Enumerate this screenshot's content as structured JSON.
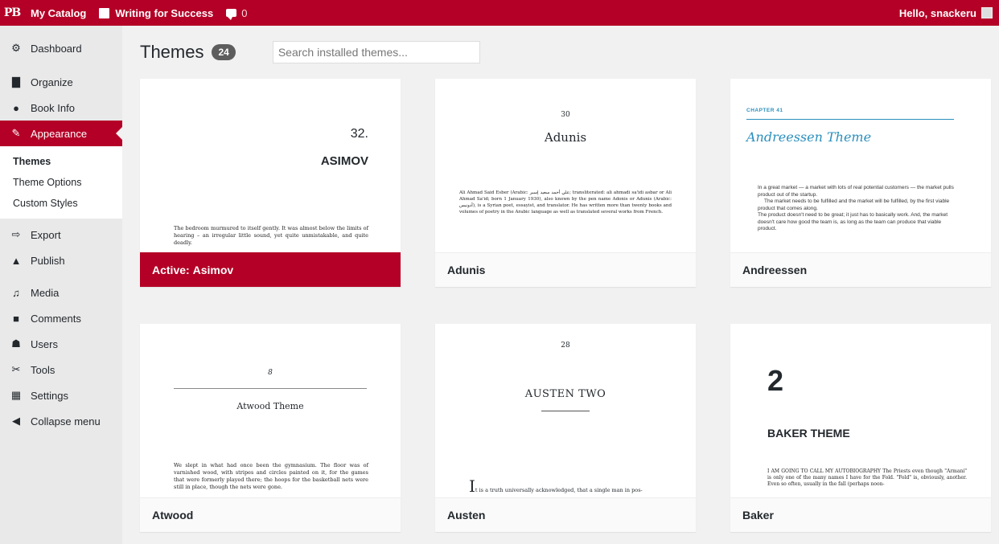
{
  "adminbar": {
    "logo": "PB",
    "catalog": "My Catalog",
    "book": "Writing for Success",
    "comments_count": "0",
    "greeting": "Hello, snackeru"
  },
  "sidebar": {
    "dashboard": "Dashboard",
    "organize": "Organize",
    "book_info": "Book Info",
    "appearance": "Appearance",
    "sub": {
      "themes": "Themes",
      "theme_options": "Theme Options",
      "custom_styles": "Custom Styles"
    },
    "export": "Export",
    "publish": "Publish",
    "media": "Media",
    "comments": "Comments",
    "users": "Users",
    "tools": "Tools",
    "settings": "Settings",
    "collapse": "Collapse menu"
  },
  "header": {
    "title": "Themes",
    "count": "24",
    "search_placeholder": "Search installed themes..."
  },
  "themes": [
    {
      "name": "Asimov",
      "active_prefix": "Active:",
      "preview": {
        "number": "32.",
        "title": "ASIMOV",
        "text": "The bedroom murmured to itself gently. It was almost below the limits of hearing – an irregular little sound, yet quite unmistakable, and quite deadly."
      }
    },
    {
      "name": "Adunis",
      "preview": {
        "number": "30",
        "title": "Adunis",
        "text": "Ali Ahmad Said Esber (Arabic: علي أحمد سعيد إسبر; transliterated: ali ahmadi sa'idi asbar or Ali Ahmad Sa'id; born 1 January 1930), also known by the pen name Adonis or Adunis (Arabic: أدونيس), is a Syrian poet, essayist, and translator. He has written more than twenty books and volumes of poetry in the Arabic language as well as translated several works from French."
      }
    },
    {
      "name": "Andreessen",
      "preview": {
        "chapter": "CHAPTER 41",
        "title": "Andreessen Theme",
        "text1": "In a great market — a market with lots of real potential customers — the market pulls product out of the startup.",
        "text2": "The market needs to be fulfilled and the market will be fulfilled, by the first viable product that comes along.",
        "text3": "The product doesn't need to be great; it just has to basically work. And, the market doesn't care how good the team is, as long as the team can produce that viable product."
      }
    },
    {
      "name": "Atwood",
      "preview": {
        "number": "8",
        "title": "Atwood Theme",
        "text": "We slept in what had once been the gymnasium. The floor was of varnished wood, with stripes and circles painted on it, for the games that were formerly played there; the hoops for the basketball nets were still in place, though the nets were gone."
      }
    },
    {
      "name": "Austen",
      "preview": {
        "number": "28",
        "title": "AUSTEN TWO",
        "dropcap": "I",
        "text": "t is a truth universally acknowledged, that a single man in pos-"
      }
    },
    {
      "name": "Baker",
      "preview": {
        "number": "2",
        "title": "BAKER THEME",
        "text": "I AM GOING TO CALL MY AUTOBIOGRAPHY The Priests even though \"Armani\" is only one of the many names I have for the Fold. \"Fold\" is, obviously, another. Even so often, usually in the fall (perhaps noon-"
      }
    }
  ],
  "colors": {
    "brand": "#b40026",
    "sidebar_bg": "#e9e9e9",
    "page_bg": "#f1f1f1",
    "andreessen_accent": "#2a8fbd"
  },
  "icons": [
    "dashboard-icon",
    "organize-icon",
    "info-icon",
    "appearance-icon",
    "export-icon",
    "publish-icon",
    "media-icon",
    "comments-icon",
    "users-icon",
    "tools-icon",
    "settings-icon",
    "collapse-icon"
  ]
}
